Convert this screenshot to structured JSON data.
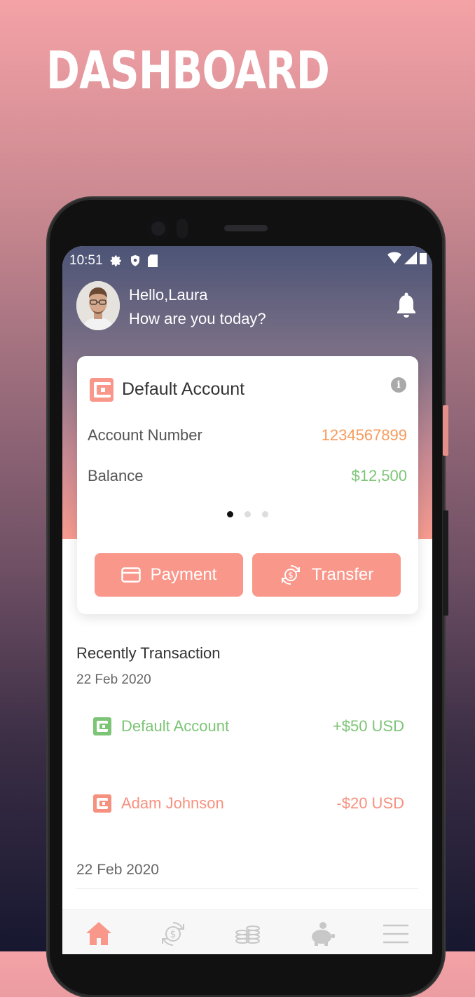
{
  "headline": "DASHBOARD",
  "status_bar": {
    "time": "10:51"
  },
  "greeting": {
    "hello": "Hello,Laura",
    "question": "How are you today?"
  },
  "account_card": {
    "title": "Default Account",
    "account_number_label": "Account Number",
    "account_number": "1234567899",
    "balance_label": "Balance",
    "balance": "$12,500",
    "carousel": {
      "count": 3,
      "active": 0
    },
    "payment_label": "Payment",
    "transfer_label": "Transfer"
  },
  "transactions": {
    "title": "Recently Transaction",
    "groups": [
      {
        "date": "22 Feb 2020",
        "items": [
          {
            "name": "Default Account",
            "amount": "+$50 USD",
            "color": "#7cc576"
          },
          {
            "name": "Adam Johnson",
            "amount": "-$20 USD",
            "color": "#f7917f"
          }
        ]
      },
      {
        "date": "22 Feb 2020",
        "items": []
      }
    ]
  },
  "bottom_nav": [
    {
      "icon": "home-icon",
      "active": true
    },
    {
      "icon": "transfer-icon",
      "active": false
    },
    {
      "icon": "coins-icon",
      "active": false
    },
    {
      "icon": "piggy-bank-icon",
      "active": false
    },
    {
      "icon": "menu-icon",
      "active": false
    }
  ],
  "colors": {
    "accent": "#fa978b",
    "account_number": "#f79a5c",
    "balance": "#7cc576",
    "income": "#7cc576",
    "expense": "#f7917f"
  }
}
